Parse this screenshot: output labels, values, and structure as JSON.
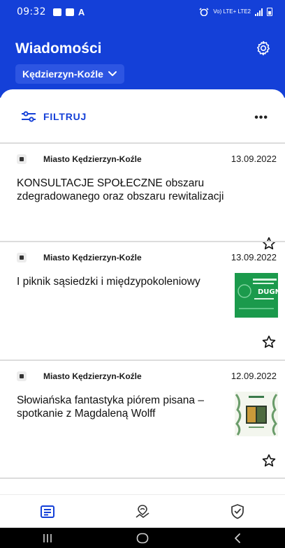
{
  "status_bar": {
    "time": "09:32",
    "network_label": "Vo) LTE+ LTE2"
  },
  "header": {
    "title": "Wiadomości",
    "city": "Kędzierzyn-Koźle"
  },
  "toolbar": {
    "filter_label": "FILTRUJ",
    "more_label": "•••"
  },
  "news": [
    {
      "source": "Miasto Kędzierzyn-Koźle",
      "date": "13.09.2022",
      "title": "KONSULTACJE SPOŁECZNE obszaru zdegradowanego oraz obszaru rewitalizacji",
      "has_image": false
    },
    {
      "source": "Miasto Kędzierzyn-Koźle",
      "date": "13.09.2022",
      "title": "I piknik sąsiedzki i międzypokoleniowy",
      "has_image": true,
      "image_text": "DUGNA"
    },
    {
      "source": "Miasto Kędzierzyn-Koźle",
      "date": "12.09.2022",
      "title": "Słowiańska fantastyka piórem pisana – spotkanie z Magdaleną Wolff",
      "has_image": true
    }
  ],
  "colors": {
    "brand_blue": "#1440d8",
    "select_blue": "#2d55e2",
    "thumb_green": "#1b9a4c"
  },
  "icons": {
    "settings": "gear-icon",
    "filter": "filter-sliders-icon",
    "favorite": "star-outline-icon",
    "nav_news": "newspaper-icon",
    "nav_city": "map-icon",
    "nav_safety": "shield-check-icon"
  }
}
